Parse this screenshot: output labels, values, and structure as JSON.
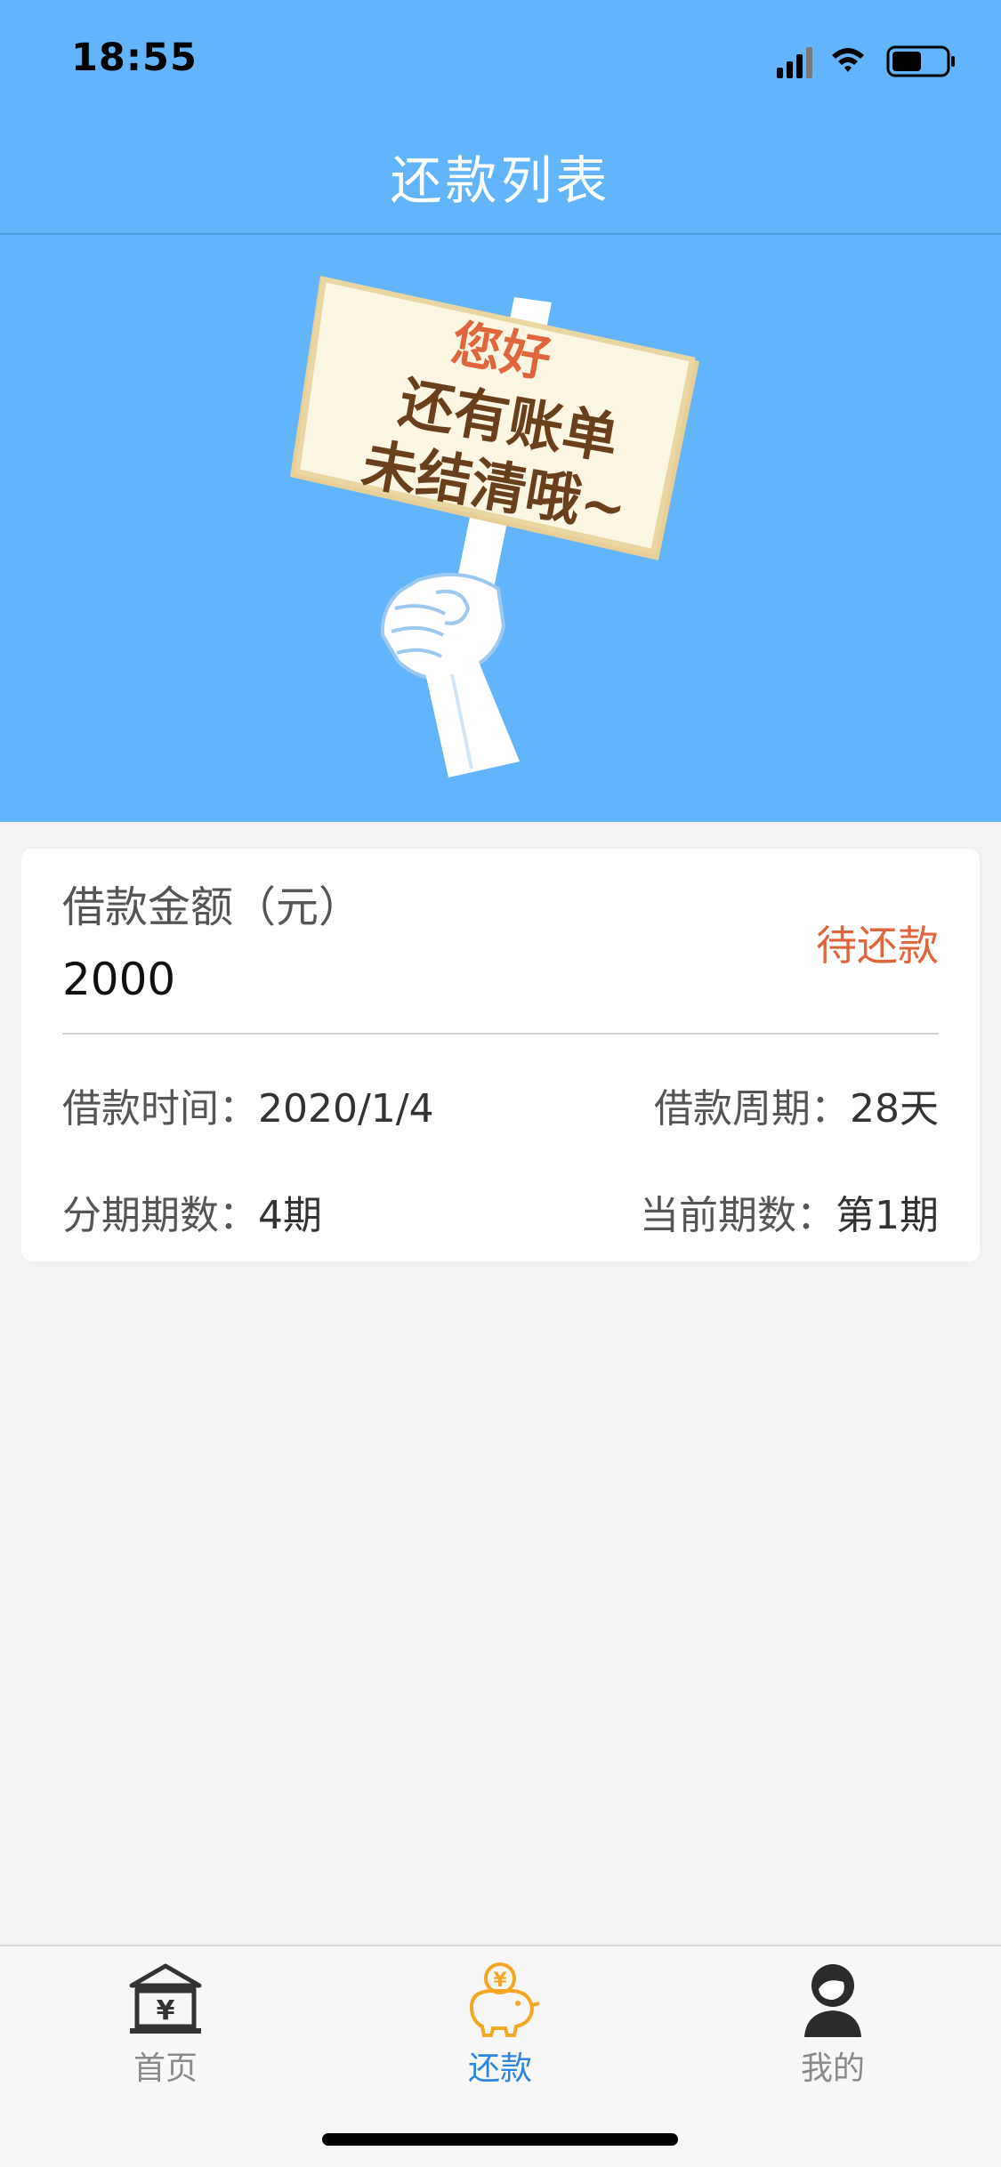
{
  "status_bar": {
    "time": "18:55"
  },
  "nav": {
    "title": "还款列表"
  },
  "banner": {
    "sign_line1": "您好",
    "sign_line2": "还有账单",
    "sign_line3": "未结清哦~"
  },
  "card": {
    "amount_label": "借款金额（元）",
    "amount_value": "2000",
    "status": "待还款",
    "loan_time_label": "借款时间：",
    "loan_time_value": "2020/1/4",
    "loan_period_label": "借款周期：",
    "loan_period_value": "28天",
    "installments_label": "分期期数：",
    "installments_value": "4期",
    "current_period_label": "当前期数：",
    "current_period_value": "第1期"
  },
  "tabbar": {
    "items": [
      {
        "label": "首页",
        "icon": "bank-yuan-icon",
        "active": false
      },
      {
        "label": "还款",
        "icon": "piggy-bank-icon",
        "active": true
      },
      {
        "label": "我的",
        "icon": "user-icon",
        "active": false
      }
    ]
  },
  "colors": {
    "header_blue": "#63b5fb",
    "status_orange": "#e0653a",
    "tab_active": "#2a86e0",
    "background": "#f2f2f2"
  }
}
